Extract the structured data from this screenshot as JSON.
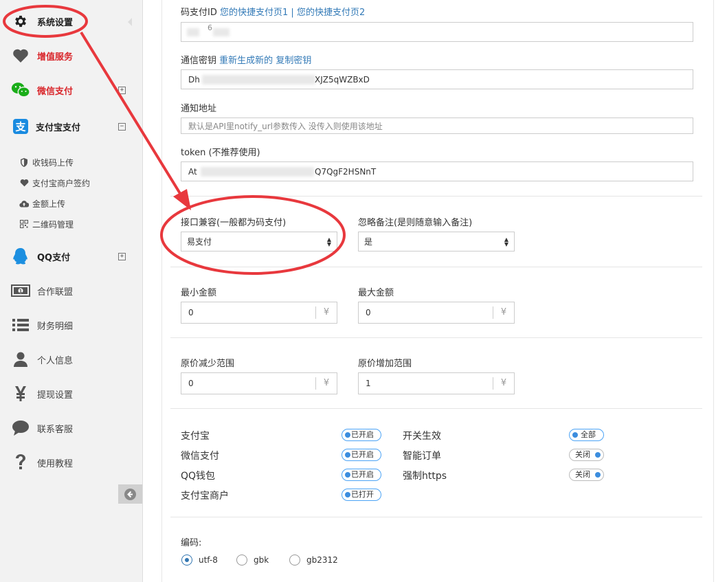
{
  "sidebar": {
    "items": [
      {
        "label": "系统设置",
        "icon": "gear-icon"
      },
      {
        "label": "增值服务",
        "icon": "heart-icon"
      },
      {
        "label": "微信支付",
        "icon": "wechat-icon",
        "toggle": "+"
      },
      {
        "label": "支付宝支付",
        "icon": "alipay-icon",
        "toggle": "−"
      },
      {
        "label": "QQ支付",
        "icon": "qq-icon",
        "toggle": "+"
      },
      {
        "label": "合作联盟",
        "icon": "money-icon"
      },
      {
        "label": "财务明细",
        "icon": "list-icon"
      },
      {
        "label": "个人信息",
        "icon": "user-icon"
      },
      {
        "label": "提现设置",
        "icon": "yen-icon"
      },
      {
        "label": "联系客服",
        "icon": "chat-icon"
      },
      {
        "label": "使用教程",
        "icon": "question-icon"
      }
    ],
    "subitems": [
      {
        "label": "收钱码上传",
        "icon": "shield-icon"
      },
      {
        "label": "支付宝商户签约",
        "icon": "heart-icon"
      },
      {
        "label": "金额上传",
        "icon": "cloud-upload-icon"
      },
      {
        "label": "二维码管理",
        "icon": "qrcode-icon"
      }
    ]
  },
  "form": {
    "code_id_label": "码支付ID",
    "link1": "您的快捷支付页1",
    "link_sep": "|",
    "link2": "您的快捷支付页2",
    "code_id_value": "6",
    "secret_label": "通信密钥",
    "regen_link": "重新生成新的",
    "copy_link": "复制密钥",
    "secret_start": "Dh",
    "secret_end": "XJZ5qWZBxD",
    "notify_label": "通知地址",
    "notify_placeholder": "默认是API里notify_url参数传入 没传入则使用该地址",
    "token_label": "token (不推荐使用)",
    "token_start": "At",
    "token_end": "Q7QgF2HSNnT",
    "compat_label": "接口兼容(一般都为码支付)",
    "compat_value": "易支付",
    "ignore_label": "忽略备注(是则随意输入备注)",
    "ignore_value": "是",
    "min_label": "最小金额",
    "min_value": "0",
    "max_label": "最大金额",
    "max_value": "0",
    "reduce_label": "原价减少范围",
    "reduce_value": "0",
    "increase_label": "原价增加范围",
    "increase_value": "1",
    "currency": "¥"
  },
  "switches": {
    "left": [
      {
        "label": "支付宝",
        "state": "已开启"
      },
      {
        "label": "微信支付",
        "state": "已开启"
      },
      {
        "label": "QQ钱包",
        "state": "已开启"
      },
      {
        "label": "支付宝商户",
        "state": "已打开"
      }
    ],
    "right": [
      {
        "label": "开关生效",
        "state": "全部"
      },
      {
        "label": "智能订单",
        "state": "关闭"
      },
      {
        "label": "强制https",
        "state": "关闭"
      }
    ]
  },
  "encoding": {
    "label": "编码:",
    "options": [
      "utf-8",
      "gbk",
      "gb2312"
    ],
    "selected": "utf-8"
  },
  "colors": {
    "accent": "#337ab7",
    "annotation": "#e8383d",
    "sidebar_bg": "#f2f2f2"
  }
}
